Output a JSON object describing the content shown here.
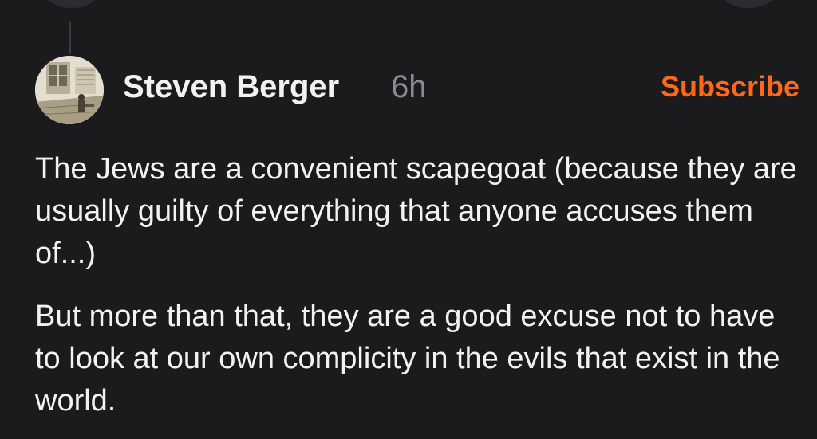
{
  "comment": {
    "author": "Steven Berger",
    "timestamp": "6h",
    "subscribe_label": "Subscribe",
    "avatar_icon": "vintage-engraving-avatar",
    "paragraphs": [
      "The Jews are a convenient scapegoat (because they are usually guilty of everything that anyone accuses them of...)",
      "But more than that, they are a good excuse not to have to look at our own complicity in the evils that exist in the world."
    ]
  },
  "colors": {
    "background": "#1b1b1d",
    "text": "#f2f2f4",
    "muted": "#8a8a90",
    "accent": "#ff6719"
  }
}
